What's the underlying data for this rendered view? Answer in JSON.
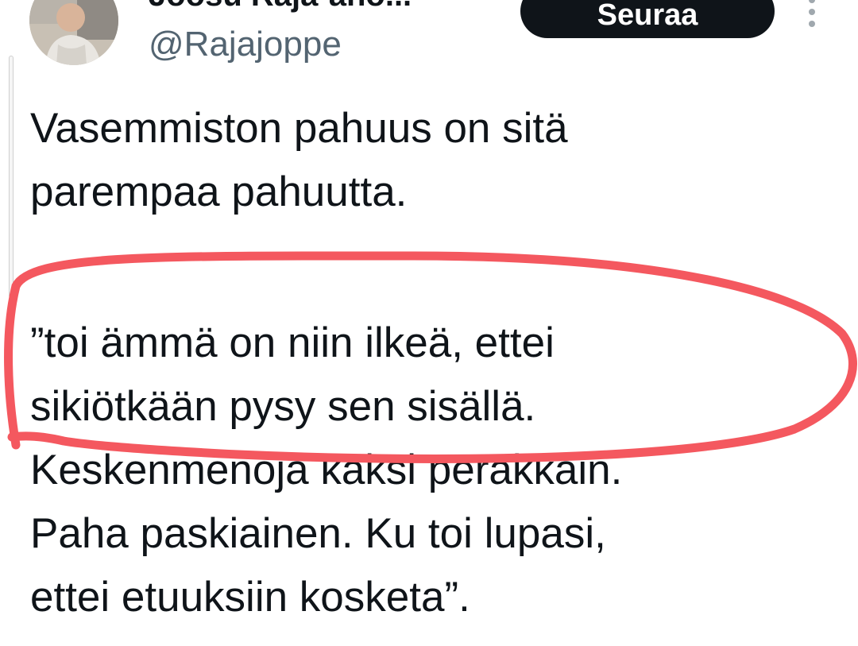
{
  "author": {
    "display_name": "Joosu Raja-aho...",
    "handle": "@Rajajoppe"
  },
  "follow_button": {
    "label": "Seuraa"
  },
  "tweet": {
    "paragraph1": [
      "Vasemmiston pahuus on sitä",
      "parempaa pahuutta."
    ],
    "paragraph2": [
      "”toi ämmä on niin ilkeä, ettei",
      "sikiötkään pysy sen sisällä.",
      "Keskenmenoja kaksi peräkkäin.",
      "Paha paskiainen. Ku toi lupasi,",
      "ettei etuuksiin kosketa”."
    ]
  },
  "colors": {
    "text": "#0f1419",
    "handle": "#536471",
    "button_bg": "#0f1419",
    "annotation": "#f4585f"
  },
  "icons": {
    "more": "vertical-ellipsis-icon",
    "annotation": "red-hand-drawn-ellipse"
  }
}
